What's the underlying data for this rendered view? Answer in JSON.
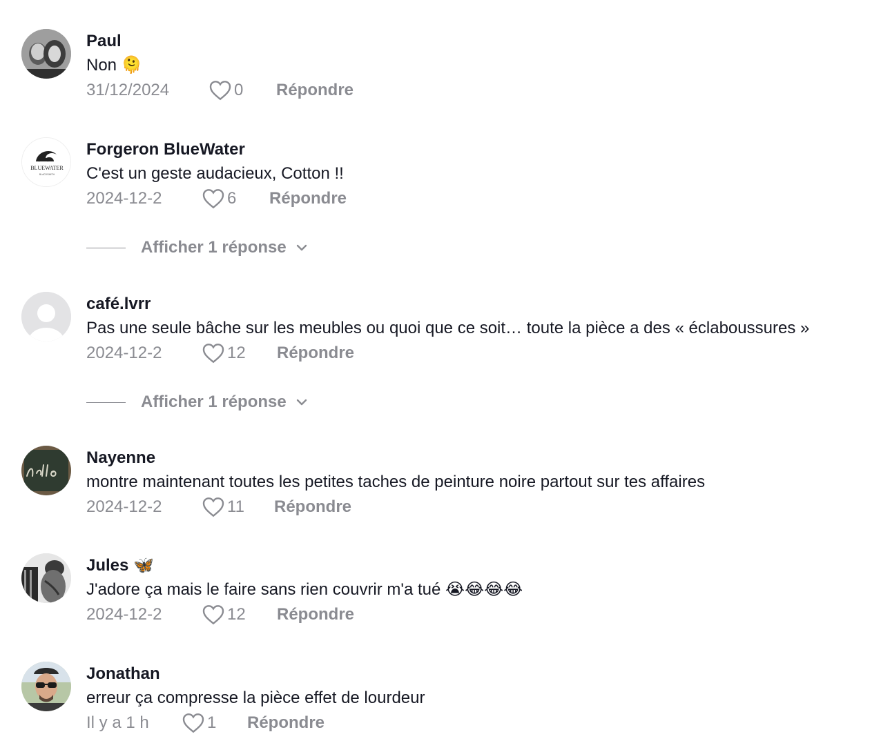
{
  "comments": [
    {
      "username": "Paul",
      "text": "Non 🫠",
      "date": "31/12/2024",
      "likes": "0",
      "reply_label": "Répondre",
      "avatar_icon": "avatar-photo"
    },
    {
      "username": "Forgeron BlueWater",
      "text": "C'est un geste audacieux, Cotton !!",
      "date": "2024-12-2",
      "likes": "6",
      "reply_label": "Répondre",
      "avatar_icon": "bluewater-logo",
      "avatar_text": "BLUEWATER",
      "avatar_subtext": "BLACKSMITH",
      "view_replies": "Afficher 1 réponse"
    },
    {
      "username": "café.lvrr",
      "text": "Pas une seule bâche sur les meubles ou quoi que ce soit… toute la pièce a des « éclaboussures »",
      "date": "2024-12-2",
      "likes": "12",
      "reply_label": "Répondre",
      "avatar_icon": "default-avatar",
      "view_replies": "Afficher 1 réponse"
    },
    {
      "username": "Nayenne",
      "text": "montre maintenant toutes les petites taches de peinture noire partout sur tes affaires",
      "date": "2024-12-2",
      "likes": "11",
      "reply_label": "Répondre",
      "avatar_icon": "chalkboard-avatar"
    },
    {
      "username": "Jules 🦋",
      "text": "J'adore ça mais le faire sans rien couvrir m'a tué 😭😂😂😂",
      "date": "2024-12-2",
      "likes": "12",
      "reply_label": "Répondre",
      "avatar_icon": "avatar-photo"
    },
    {
      "username": "Jonathan",
      "text": "erreur ça compresse la pièce effet de lourdeur",
      "date": "Il y a 1 h",
      "likes": "1",
      "reply_label": "Répondre",
      "avatar_icon": "avatar-photo"
    }
  ],
  "colors": {
    "text": "#161823",
    "muted": "#8a8b91",
    "background": "#ffffff"
  }
}
